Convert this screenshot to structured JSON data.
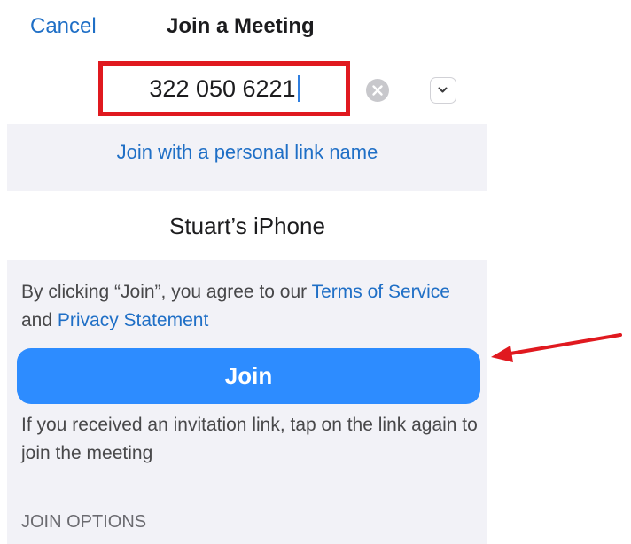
{
  "header": {
    "cancel_label": "Cancel",
    "title": "Join a Meeting"
  },
  "meeting_id": {
    "value": "322 050 6221",
    "clear_icon": "clear-circle-icon",
    "dropdown_icon": "chevron-down-icon",
    "highlight_color": "#e0191f"
  },
  "personal_link_label": "Join with a personal link name",
  "display_name": {
    "value": "Stuart’s iPhone"
  },
  "terms": {
    "prefix": "By clicking “Join”, you agree to our ",
    "terms_link": "Terms of Service",
    "conjunction": " and ",
    "privacy_link": "Privacy Statement"
  },
  "join_button": {
    "label": "Join",
    "color": "#2d8cff"
  },
  "invite_hint": "If you received an invitation link, tap on the link again to join the meeting",
  "join_options_header": "JOIN OPTIONS",
  "annotation": {
    "arrow_color": "#e0191f",
    "arrow_icon": "arrow-left-icon"
  }
}
